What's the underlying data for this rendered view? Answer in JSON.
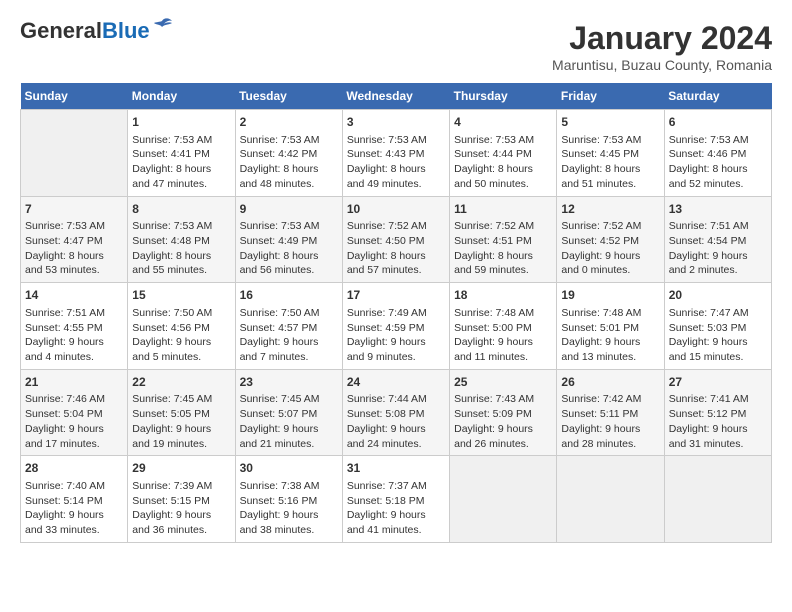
{
  "header": {
    "logo_line1": "General",
    "logo_line2": "Blue",
    "month_year": "January 2024",
    "location": "Maruntisu, Buzau County, Romania"
  },
  "weekdays": [
    "Sunday",
    "Monday",
    "Tuesday",
    "Wednesday",
    "Thursday",
    "Friday",
    "Saturday"
  ],
  "weeks": [
    [
      {
        "day": "",
        "info": ""
      },
      {
        "day": "1",
        "info": "Sunrise: 7:53 AM\nSunset: 4:41 PM\nDaylight: 8 hours\nand 47 minutes."
      },
      {
        "day": "2",
        "info": "Sunrise: 7:53 AM\nSunset: 4:42 PM\nDaylight: 8 hours\nand 48 minutes."
      },
      {
        "day": "3",
        "info": "Sunrise: 7:53 AM\nSunset: 4:43 PM\nDaylight: 8 hours\nand 49 minutes."
      },
      {
        "day": "4",
        "info": "Sunrise: 7:53 AM\nSunset: 4:44 PM\nDaylight: 8 hours\nand 50 minutes."
      },
      {
        "day": "5",
        "info": "Sunrise: 7:53 AM\nSunset: 4:45 PM\nDaylight: 8 hours\nand 51 minutes."
      },
      {
        "day": "6",
        "info": "Sunrise: 7:53 AM\nSunset: 4:46 PM\nDaylight: 8 hours\nand 52 minutes."
      }
    ],
    [
      {
        "day": "7",
        "info": "Sunrise: 7:53 AM\nSunset: 4:47 PM\nDaylight: 8 hours\nand 53 minutes."
      },
      {
        "day": "8",
        "info": "Sunrise: 7:53 AM\nSunset: 4:48 PM\nDaylight: 8 hours\nand 55 minutes."
      },
      {
        "day": "9",
        "info": "Sunrise: 7:53 AM\nSunset: 4:49 PM\nDaylight: 8 hours\nand 56 minutes."
      },
      {
        "day": "10",
        "info": "Sunrise: 7:52 AM\nSunset: 4:50 PM\nDaylight: 8 hours\nand 57 minutes."
      },
      {
        "day": "11",
        "info": "Sunrise: 7:52 AM\nSunset: 4:51 PM\nDaylight: 8 hours\nand 59 minutes."
      },
      {
        "day": "12",
        "info": "Sunrise: 7:52 AM\nSunset: 4:52 PM\nDaylight: 9 hours\nand 0 minutes."
      },
      {
        "day": "13",
        "info": "Sunrise: 7:51 AM\nSunset: 4:54 PM\nDaylight: 9 hours\nand 2 minutes."
      }
    ],
    [
      {
        "day": "14",
        "info": "Sunrise: 7:51 AM\nSunset: 4:55 PM\nDaylight: 9 hours\nand 4 minutes."
      },
      {
        "day": "15",
        "info": "Sunrise: 7:50 AM\nSunset: 4:56 PM\nDaylight: 9 hours\nand 5 minutes."
      },
      {
        "day": "16",
        "info": "Sunrise: 7:50 AM\nSunset: 4:57 PM\nDaylight: 9 hours\nand 7 minutes."
      },
      {
        "day": "17",
        "info": "Sunrise: 7:49 AM\nSunset: 4:59 PM\nDaylight: 9 hours\nand 9 minutes."
      },
      {
        "day": "18",
        "info": "Sunrise: 7:48 AM\nSunset: 5:00 PM\nDaylight: 9 hours\nand 11 minutes."
      },
      {
        "day": "19",
        "info": "Sunrise: 7:48 AM\nSunset: 5:01 PM\nDaylight: 9 hours\nand 13 minutes."
      },
      {
        "day": "20",
        "info": "Sunrise: 7:47 AM\nSunset: 5:03 PM\nDaylight: 9 hours\nand 15 minutes."
      }
    ],
    [
      {
        "day": "21",
        "info": "Sunrise: 7:46 AM\nSunset: 5:04 PM\nDaylight: 9 hours\nand 17 minutes."
      },
      {
        "day": "22",
        "info": "Sunrise: 7:45 AM\nSunset: 5:05 PM\nDaylight: 9 hours\nand 19 minutes."
      },
      {
        "day": "23",
        "info": "Sunrise: 7:45 AM\nSunset: 5:07 PM\nDaylight: 9 hours\nand 21 minutes."
      },
      {
        "day": "24",
        "info": "Sunrise: 7:44 AM\nSunset: 5:08 PM\nDaylight: 9 hours\nand 24 minutes."
      },
      {
        "day": "25",
        "info": "Sunrise: 7:43 AM\nSunset: 5:09 PM\nDaylight: 9 hours\nand 26 minutes."
      },
      {
        "day": "26",
        "info": "Sunrise: 7:42 AM\nSunset: 5:11 PM\nDaylight: 9 hours\nand 28 minutes."
      },
      {
        "day": "27",
        "info": "Sunrise: 7:41 AM\nSunset: 5:12 PM\nDaylight: 9 hours\nand 31 minutes."
      }
    ],
    [
      {
        "day": "28",
        "info": "Sunrise: 7:40 AM\nSunset: 5:14 PM\nDaylight: 9 hours\nand 33 minutes."
      },
      {
        "day": "29",
        "info": "Sunrise: 7:39 AM\nSunset: 5:15 PM\nDaylight: 9 hours\nand 36 minutes."
      },
      {
        "day": "30",
        "info": "Sunrise: 7:38 AM\nSunset: 5:16 PM\nDaylight: 9 hours\nand 38 minutes."
      },
      {
        "day": "31",
        "info": "Sunrise: 7:37 AM\nSunset: 5:18 PM\nDaylight: 9 hours\nand 41 minutes."
      },
      {
        "day": "",
        "info": ""
      },
      {
        "day": "",
        "info": ""
      },
      {
        "day": "",
        "info": ""
      }
    ]
  ]
}
